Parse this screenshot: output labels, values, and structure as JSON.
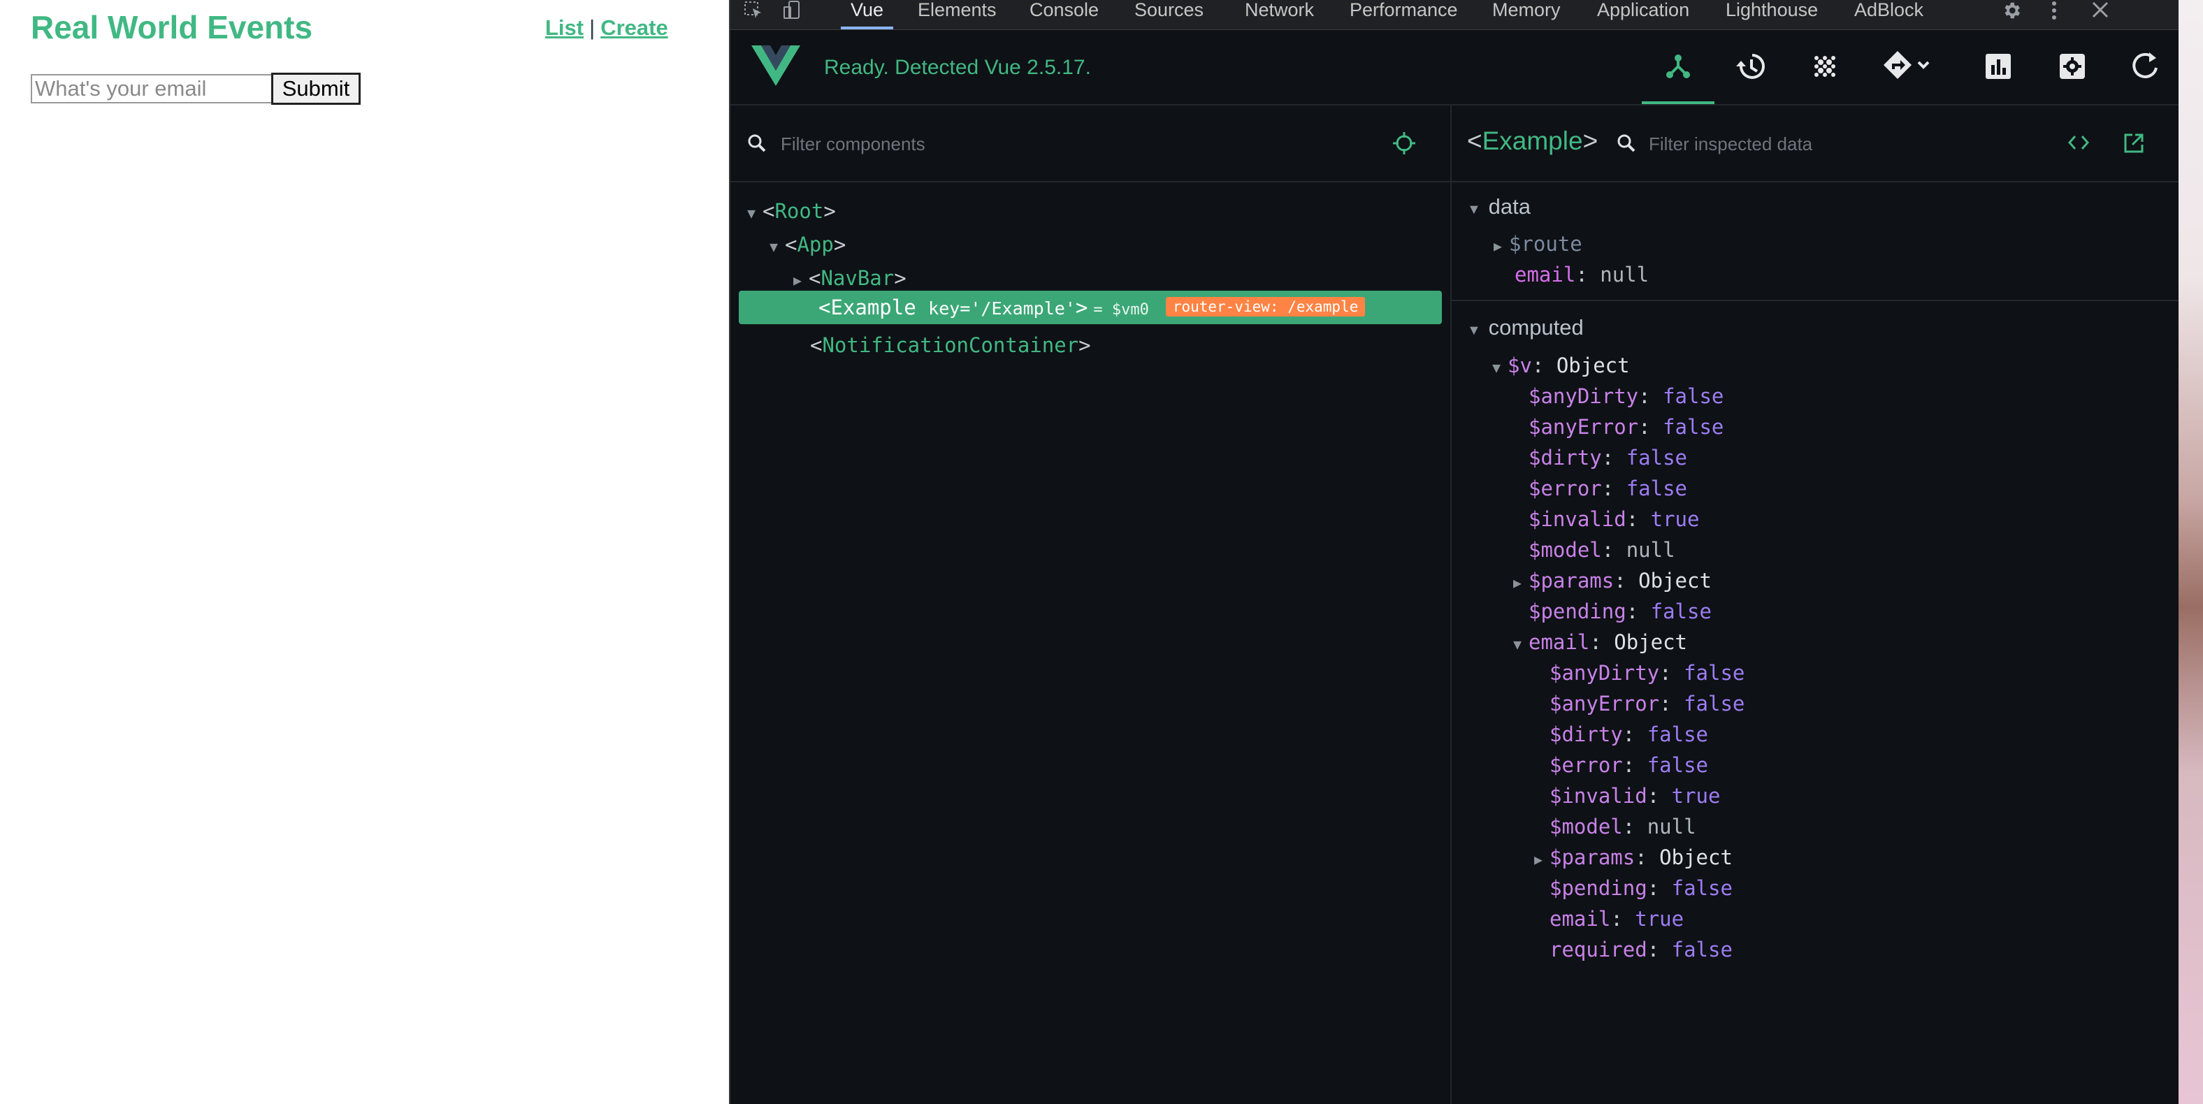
{
  "app": {
    "title": "Real World Events",
    "nav": {
      "list": "List",
      "separator": "|",
      "create": "Create"
    },
    "form": {
      "email_placeholder": "What's your email",
      "submit_label": "Submit"
    }
  },
  "devtools": {
    "tabs": [
      "Vue",
      "Elements",
      "Console",
      "Sources",
      "Network",
      "Performance",
      "Memory",
      "Application",
      "Lighthouse",
      "AdBlock"
    ],
    "active_tab": "Vue",
    "vue_status": "Ready. Detected Vue 2.5.17.",
    "header_icons": [
      "components-icon",
      "history-icon",
      "vuex-icon",
      "router-icon",
      "performance-icon",
      "settings-icon",
      "refresh-icon"
    ],
    "components": {
      "filter_placeholder": "Filter components",
      "tree": [
        {
          "name": "Root",
          "depth": 0,
          "expanded": true
        },
        {
          "name": "App",
          "depth": 1,
          "expanded": true
        },
        {
          "name": "NavBar",
          "depth": 2,
          "expanded": false
        },
        {
          "name": "Example",
          "depth": 2,
          "selected": true,
          "key": "key='/Example'",
          "vm": "= $vm0",
          "badge": "router-view: /example"
        },
        {
          "name": "NotificationContainer",
          "depth": 2
        }
      ]
    },
    "inspector": {
      "component": "Example",
      "filter_placeholder": "Filter inspected data",
      "data_label": "data",
      "data": [
        {
          "key": "$route",
          "value": "",
          "collapsed": true
        },
        {
          "key": "email",
          "value": "null"
        }
      ],
      "computed_label": "computed",
      "computed": [
        {
          "key": "$v",
          "value": "Object",
          "depth": 0,
          "expanded": true
        },
        {
          "key": "$anyDirty",
          "value": "false",
          "depth": 1
        },
        {
          "key": "$anyError",
          "value": "false",
          "depth": 1
        },
        {
          "key": "$dirty",
          "value": "false",
          "depth": 1
        },
        {
          "key": "$error",
          "value": "false",
          "depth": 1
        },
        {
          "key": "$invalid",
          "value": "true",
          "depth": 1
        },
        {
          "key": "$model",
          "value": "null",
          "depth": 1
        },
        {
          "key": "$params",
          "value": "Object",
          "depth": 1,
          "collapsed": true
        },
        {
          "key": "$pending",
          "value": "false",
          "depth": 1
        },
        {
          "key": "email",
          "value": "Object",
          "depth": 1,
          "expanded": true
        },
        {
          "key": "$anyDirty",
          "value": "false",
          "depth": 2
        },
        {
          "key": "$anyError",
          "value": "false",
          "depth": 2
        },
        {
          "key": "$dirty",
          "value": "false",
          "depth": 2
        },
        {
          "key": "$error",
          "value": "false",
          "depth": 2
        },
        {
          "key": "$invalid",
          "value": "true",
          "depth": 2
        },
        {
          "key": "$model",
          "value": "null",
          "depth": 2
        },
        {
          "key": "$params",
          "value": "Object",
          "depth": 2,
          "collapsed": true
        },
        {
          "key": "$pending",
          "value": "false",
          "depth": 2
        },
        {
          "key": "email",
          "value": "true",
          "depth": 2
        },
        {
          "key": "required",
          "value": "false",
          "depth": 2
        }
      ]
    }
  },
  "colors": {
    "vue_green": "#41b883",
    "badge_orange": "#ff8344",
    "selection": "#3ba776",
    "panel_bg": "#0e1115"
  }
}
